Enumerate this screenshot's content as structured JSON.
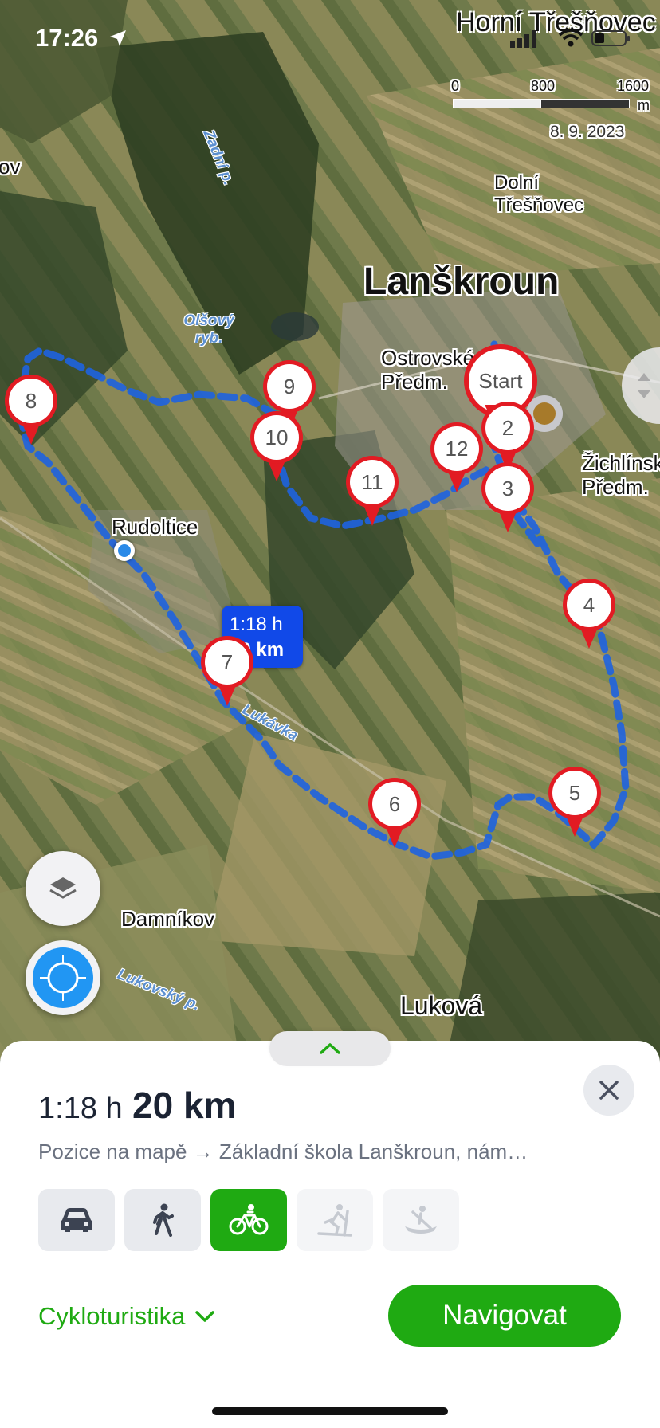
{
  "status": {
    "time": "17:26"
  },
  "map": {
    "header_place": "Horní Třešňovec",
    "scale_labels": [
      "0",
      "800",
      "1600"
    ],
    "scale_unit": "m",
    "imagery_date": "8. 9. 2023",
    "place_labels": {
      "lanskroun": "Lanškroun",
      "dolni": "Dolní Třešňovec",
      "ostrovske": "Ostrovské Předm.",
      "zichlinske": "Žichlínské Předm.",
      "rudoltice": "Rudoltice",
      "damnikov": "Damníkov",
      "lukova": "Luková",
      "left_edge": "ov"
    },
    "water_labels": {
      "zadni": "Zadní p.",
      "olsovy": "Olšový ryb.",
      "lukavka": "Lukávka",
      "lukovsky": "Lukovský p."
    },
    "route_badge": {
      "time": "1:18 h",
      "distance": "20 km"
    },
    "start_label": "Start",
    "waypoints": [
      "2",
      "3",
      "4",
      "5",
      "6",
      "7",
      "8",
      "9",
      "10",
      "11",
      "12"
    ]
  },
  "route_panel": {
    "duration": "1:18 h",
    "distance": "20 km",
    "from_to": "Pozice na mapě → Základní škola Lanškroun, nám…",
    "modes": [
      "car-icon",
      "walk-icon",
      "bike-icon",
      "ski-icon",
      "canoe-icon"
    ],
    "selected_mode": "bike",
    "profile": "Cykloturistika",
    "navigate_label": "Navigovat",
    "accent_color": "#1faa12"
  }
}
